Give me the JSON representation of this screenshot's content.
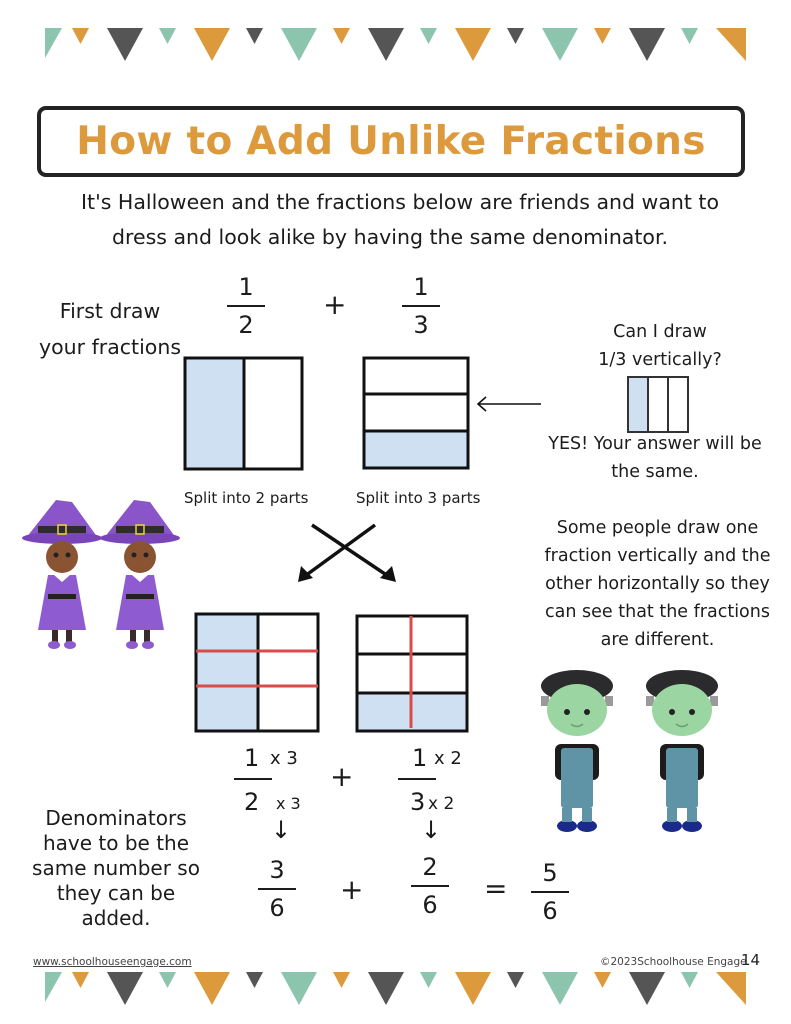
{
  "colors": {
    "teal": "#8cc5ae",
    "orange": "#dc9a3c",
    "dark": "#555555",
    "shade": "#cfe0f2",
    "red": "#d94a4a",
    "ink": "#111111"
  },
  "bunting": {
    "pattern": [
      "teal-large",
      "orange-small",
      "dark-large",
      "teal-small",
      "orange-large",
      "dark-small"
    ]
  },
  "header": {
    "title": "How to Add Unlike Fractions",
    "intro_line1": "It's Halloween and the fractions below are friends and want to",
    "intro_line2": "dress and look alike by having the same denominator."
  },
  "step1": {
    "label_line1": "First draw",
    "label_line2": "your fractions",
    "fraction_a": {
      "numerator": "1",
      "denominator": "2"
    },
    "operator": "+",
    "fraction_b": {
      "numerator": "1",
      "denominator": "3"
    },
    "caption_a": "Split into 2 parts",
    "caption_b": "Split into 3 parts"
  },
  "sidebar_question": {
    "line1": "Can I draw",
    "line2": "1/3 vertically?",
    "answer_line1": "YES! Your answer will be",
    "answer_line2": "the same."
  },
  "sidebar_note": {
    "lines": [
      "Some people draw one",
      "fraction vertically and the",
      "other horizontally so they",
      "can see that the fractions",
      "are different."
    ]
  },
  "equivalent": {
    "fraction_a": {
      "numerator": "1",
      "numerator_mult": "x 3",
      "denominator": "2",
      "denominator_mult": "x 3"
    },
    "operator": "+",
    "fraction_b": {
      "numerator": "1",
      "numerator_mult": "x 2",
      "denominator": "3",
      "denominator_mult": "x 2"
    },
    "arrow": "↓"
  },
  "result": {
    "fraction_a": {
      "numerator": "3",
      "denominator": "6"
    },
    "plus": "+",
    "fraction_b": {
      "numerator": "2",
      "denominator": "6"
    },
    "equals": "=",
    "sum": {
      "numerator": "5",
      "denominator": "6"
    }
  },
  "note_left": {
    "lines": [
      "Denominators",
      "have to be the",
      "same number so",
      "they can be",
      "added."
    ]
  },
  "illustrations": {
    "witches": "witch-girl-illustration",
    "monsters": "frankenstein-boy-illustration"
  },
  "footer": {
    "website": "www.schoolhouseengage.com",
    "copyright": "©2023Schoolhouse Engage",
    "page_number": "14"
  }
}
